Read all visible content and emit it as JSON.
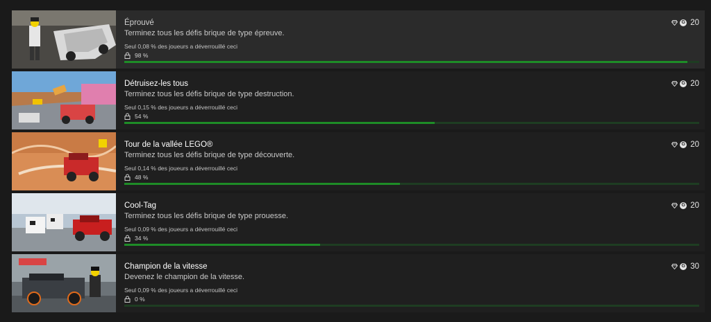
{
  "achievements": [
    {
      "title": "Éprouvé",
      "description": "Terminez tous les défis brique de type épreuve.",
      "rarity": "Seul 0,08 % des joueurs a déverrouillé ceci",
      "progress_label": "98 %",
      "progress": 0.98,
      "score": "20",
      "thumbnail": "lego-race-car-image"
    },
    {
      "title": "Détruisez-les tous",
      "description": "Terminez tous les défis brique de type destruction.",
      "rarity": "Seul 0,15 % des joueurs a déverrouillé ceci",
      "progress_label": "54 %",
      "progress": 0.54,
      "score": "20",
      "thumbnail": "lego-destruction-image"
    },
    {
      "title": "Tour de la vallée LEGO®",
      "description": "Terminez tous les défis brique de type découverte.",
      "rarity": "Seul 0,14 % des joueurs a déverrouillé ceci",
      "progress_label": "48 %",
      "progress": 0.48,
      "score": "20",
      "thumbnail": "lego-valley-image"
    },
    {
      "title": "Cool-Tag",
      "description": "Terminez tous les défis brique de type prouesse.",
      "rarity": "Seul 0,09 % des joueurs a déverrouillé ceci",
      "progress_label": "34 %",
      "progress": 0.34,
      "score": "20",
      "thumbnail": "lego-cows-image"
    },
    {
      "title": "Champion de la vitesse",
      "description": "Devenez le champion de la vitesse.",
      "rarity": "Seul 0,09 % des joueurs a déverrouillé ceci",
      "progress_label": "0 %",
      "progress": 0.0,
      "score": "30",
      "thumbnail": "lego-champion-image"
    }
  ],
  "icons": {
    "gamerscore": "G",
    "rarity": "diamond-icon",
    "lock": "lock-icon"
  },
  "colors": {
    "progress_fill": "#1e8d27",
    "progress_track": "#1e3d22",
    "background": "#1a1a1a"
  }
}
